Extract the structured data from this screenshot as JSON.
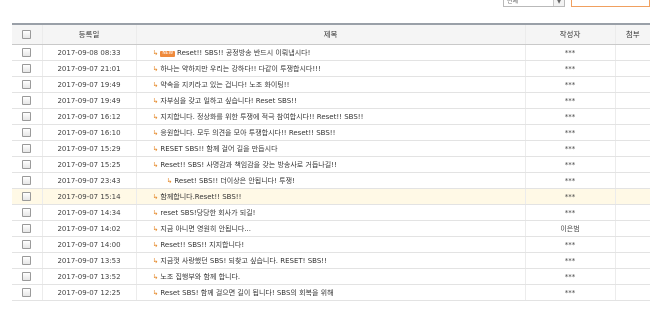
{
  "search_bar": {
    "select_value": "전체",
    "select_arrow": "▼"
  },
  "table": {
    "headers": {
      "select_all": "",
      "date": "등록일",
      "title": "제목",
      "author": "작성자",
      "views": "첨부"
    },
    "rows": [
      {
        "date": "2017-09-08 08:33",
        "title": "Reset!! SBS!! 공정방송 반드시 이뤄냅시다!",
        "author": "***",
        "new_badge": "NEW"
      },
      {
        "date": "2017-09-07 21:01",
        "title": "하나는 약하지만 우리는 강하다!! 다같이 투쟁합시다!!!",
        "author": "***"
      },
      {
        "date": "2017-09-07 19:49",
        "title": "약속을 지키라고 있는 겁니다! 노조 화이팅!!",
        "author": "***"
      },
      {
        "date": "2017-09-07 19:49",
        "title": "자부심을 갖고 일하고 싶습니다! Reset SBS!!",
        "author": "***"
      },
      {
        "date": "2017-09-07 16:12",
        "title": "지지합니다. 정상화를 위한 투쟁에 적극 참여합시다!! Reset!! SBS!!",
        "author": "***"
      },
      {
        "date": "2017-09-07 16:10",
        "title": "응원합니다. 모두 의견을 모아 투쟁합시다!! Reset!! SBS!!",
        "author": "***"
      },
      {
        "date": "2017-09-07 15:29",
        "title": "RESET SBS!! 함께 걸어 길을 만듭시다",
        "author": "***"
      },
      {
        "date": "2017-09-07 15:25",
        "title": "Reset!! SBS! 사명감과 책임감을 갖는 방송사로 거듭나길!!",
        "author": "***"
      },
      {
        "date": "2017-09-07 23:43",
        "title": "Reset! SBS!! 더이상은 안됩니다! 투쟁!",
        "author": "***",
        "indent": true
      },
      {
        "date": "2017-09-07 15:14",
        "title": "함께합니다.Reset!! SBS!!",
        "author": "***",
        "highlight": true
      },
      {
        "date": "2017-09-07 14:34",
        "title": "reset SBS!당당한 회사가 되길!",
        "author": "***"
      },
      {
        "date": "2017-09-07 14:02",
        "title": "지금 아니면 영원히 안됩니다...",
        "author": "이은범"
      },
      {
        "date": "2017-09-07 14:00",
        "title": "Reset!! SBS!! 지지합니다!",
        "author": "***"
      },
      {
        "date": "2017-09-07 13:53",
        "title": "지금껏 사랑했던 SBS! 되찾고 싶습니다. RESET! SBS!!",
        "author": "***"
      },
      {
        "date": "2017-09-07 13:52",
        "title": "노조 집행부와 함께 합니다.",
        "author": "***"
      },
      {
        "date": "2017-09-07 12:25",
        "title": "Reset SBS! 함께 걸으면 길이 됩니다! SBS의 회복을 위해",
        "author": "***"
      }
    ]
  },
  "icons": {
    "reply": "reply-arrow-icon",
    "checkbox": "checkbox-icon"
  },
  "colors": {
    "accent": "#ef8a3c",
    "highlight_row": "#fff9e6",
    "header_bg": "#f5f5f5"
  }
}
